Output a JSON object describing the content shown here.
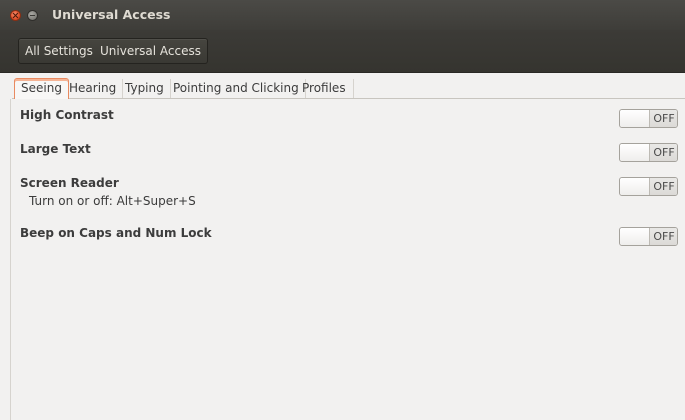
{
  "window": {
    "title": "Universal Access"
  },
  "breadcrumbs": [
    {
      "label": "All Settings"
    },
    {
      "label": "Universal Access"
    }
  ],
  "tabs": [
    {
      "label": "Seeing",
      "active": true
    },
    {
      "label": "Hearing",
      "active": false
    },
    {
      "label": "Typing",
      "active": false
    },
    {
      "label": "Pointing and Clicking",
      "active": false
    },
    {
      "label": "Profiles",
      "active": false
    }
  ],
  "settings": [
    {
      "label": "High Contrast",
      "sublabel": "",
      "state": "OFF"
    },
    {
      "label": "Large Text",
      "sublabel": "",
      "state": "OFF"
    },
    {
      "label": "Screen Reader",
      "sublabel": "Turn on or off:  Alt+Super+S",
      "state": "OFF"
    },
    {
      "label": "Beep on Caps and Num Lock",
      "sublabel": "",
      "state": "OFF"
    }
  ],
  "colors": {
    "accent": "#e98a60",
    "close_button": "#e0502a",
    "titlebar": "#3c3b37"
  }
}
